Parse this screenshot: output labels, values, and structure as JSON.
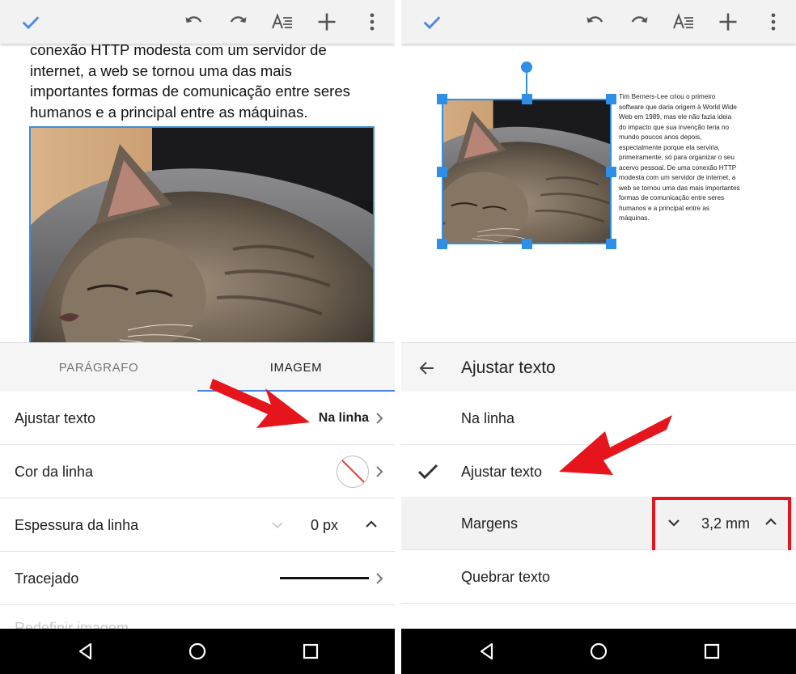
{
  "left_panel": {
    "doc_lines": [
      "conexão HTTP modesta com um servidor de",
      "internet, a web se tornou uma das mais",
      "importantes formas de comunicação entre seres",
      "humanos e a principal entre as máquinas."
    ],
    "tabs": [
      {
        "label": "PARÁGRAFO"
      },
      {
        "label": "IMAGEM"
      }
    ],
    "rows": {
      "wrap_text_label": "Ajustar texto",
      "wrap_text_value": "Na linha",
      "line_color_label": "Cor da linha",
      "line_weight_label": "Espessura da linha",
      "line_weight_value": "0 px",
      "dash_label": "Tracejado",
      "reset_label": "Redefinir imagem"
    }
  },
  "right_panel": {
    "wrap_text_lines": [
      "Tim Berners-Lee criou o primeiro",
      "software que daria origem à World Wide",
      "Web em 1989, mas ele não fazia ideia",
      "do impacto que sua invenção teria no",
      "mundo poucos anos depois,",
      "especialmente porque ela serviria,",
      "primeiramente, só para organizar o seu",
      "acervo pessoal. De uma conexão HTTP",
      "modesta com um servidor de internet, a",
      "web se tornou uma das mais importantes",
      "formas de comunicação entre seres",
      "humanos e a principal entre as",
      "máquinas."
    ],
    "header_title": "Ajustar texto",
    "options": {
      "inline": "Na linha",
      "wrap": "Ajustar texto",
      "margins_label": "Margens",
      "margins_value": "3,2 mm",
      "break": "Quebrar texto"
    }
  },
  "icons": {
    "toolbar": [
      "check-icon",
      "undo-icon",
      "redo-icon",
      "text-format-icon",
      "add-icon",
      "more-vert-icon"
    ],
    "nav": [
      "nav-back-icon",
      "nav-home-icon",
      "nav-recent-icon"
    ]
  },
  "colors": {
    "accent": "#4a86e8",
    "selection": "#2f8fe6",
    "annotation_red": "#e5151b"
  }
}
